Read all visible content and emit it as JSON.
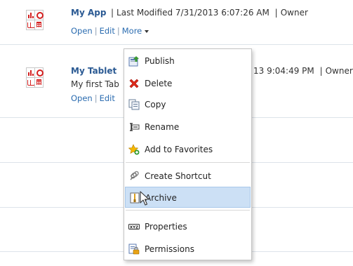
{
  "rows": [
    {
      "title": "My App",
      "modified": "Last Modified 7/31/2013 6:07:26 AM",
      "owner": "Owner",
      "links": {
        "open": "Open",
        "edit": "Edit",
        "more": "More"
      }
    },
    {
      "title": "My Tablet",
      "modified_partial": "13 9:04:49 PM",
      "owner": "Owner",
      "description": "My first Tab",
      "links": {
        "open": "Open",
        "edit": "Edit"
      }
    }
  ],
  "menu": {
    "items": [
      {
        "label": "Publish",
        "icon": "publish-icon"
      },
      {
        "label": "Delete",
        "icon": "delete-x-icon"
      },
      {
        "label": "Copy",
        "icon": "copy-icon"
      },
      {
        "label": "Rename",
        "icon": "rename-icon"
      },
      {
        "label": "Add to Favorites",
        "icon": "add-favorite-star-icon"
      },
      {
        "label": "Create Shortcut",
        "icon": "shortcut-link-icon"
      },
      {
        "label": "Archive",
        "icon": "archive-icon",
        "highlighted": true
      },
      {
        "label": "Properties",
        "icon": "properties-icon"
      },
      {
        "label": "Permissions",
        "icon": "permissions-lock-icon"
      }
    ]
  },
  "colors": {
    "title_link": "#2b5a93",
    "link": "#2b6cb0",
    "icon_red": "#d42020",
    "menu_highlight": "#cce0f5"
  }
}
